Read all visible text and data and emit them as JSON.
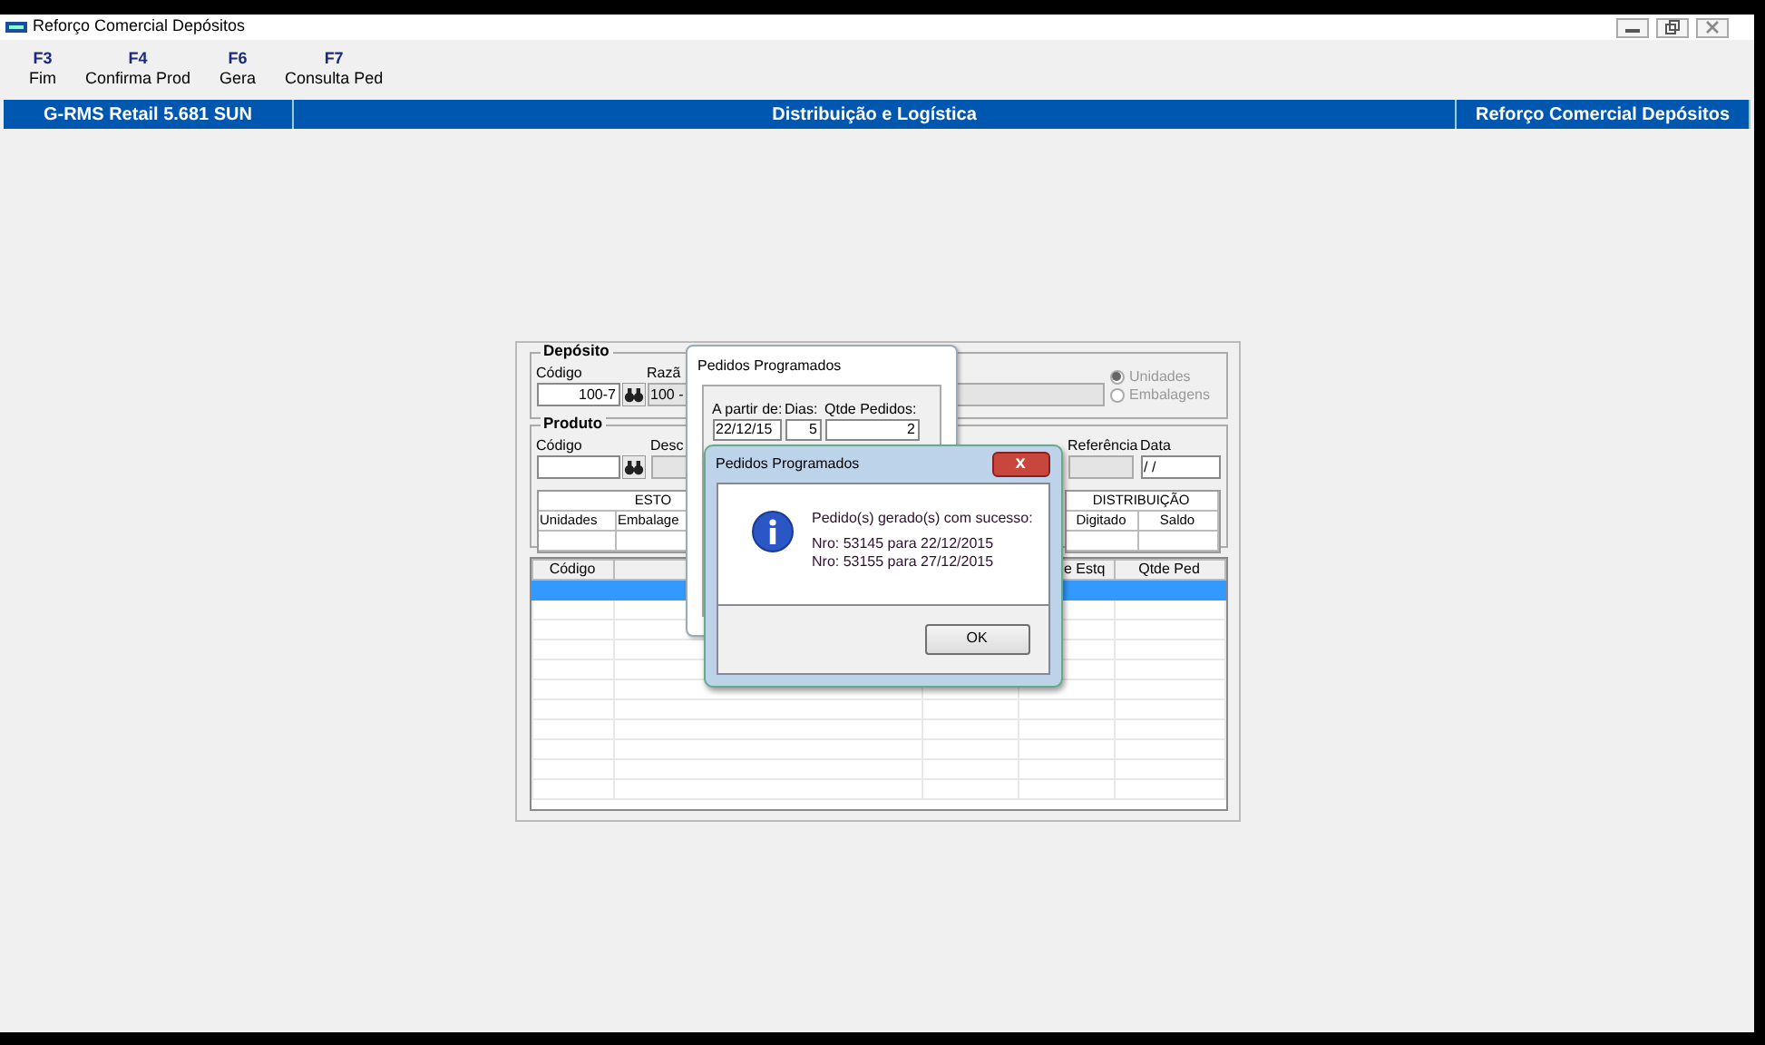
{
  "window": {
    "title": "Reforço Comercial Depósitos"
  },
  "function_keys": [
    {
      "key": "F3",
      "label": "Fim"
    },
    {
      "key": "F4",
      "label": "Confirma Prod"
    },
    {
      "key": "F6",
      "label": "Gera"
    },
    {
      "key": "F7",
      "label": "Consulta Ped"
    }
  ],
  "header_band": [
    "G-RMS Retail 5.681 SUN",
    "Distribuição e Logística",
    "Reforço Comercial Depósitos"
  ],
  "deposito": {
    "legend": "Depósito",
    "codigo_label": "Código",
    "codigo": "100-7",
    "razao_label": "Razã",
    "razao": "100 -"
  },
  "unit_options": {
    "disabled": true,
    "options": [
      {
        "label": "Unidades",
        "selected": true
      },
      {
        "label": "Embalagens",
        "selected": false
      }
    ]
  },
  "produto": {
    "legend": "Produto",
    "codigo_label": "Código",
    "descricao_label": "Desc",
    "referencia_label": "Referência",
    "data_label": "Data",
    "data": "/ /"
  },
  "estoque": {
    "title": "ESTO",
    "columns": [
      "Unidades",
      "Embalage"
    ]
  },
  "distribuicao": {
    "title": "DISTRIBUIÇÃO",
    "columns": [
      "Digitado",
      "Saldo"
    ]
  },
  "grid": {
    "columns": [
      "Código",
      "",
      "",
      "e Estq",
      "Qtde Ped"
    ],
    "rows": [
      {
        "selected": true
      },
      {
        "selected": false
      },
      {
        "selected": false
      },
      {
        "selected": false
      },
      {
        "selected": false
      },
      {
        "selected": false
      },
      {
        "selected": false
      },
      {
        "selected": false
      },
      {
        "selected": false
      },
      {
        "selected": false
      },
      {
        "selected": false
      }
    ]
  },
  "schedule_dialog": {
    "title": "Pedidos Programados",
    "fields": [
      {
        "label": "A partir de:",
        "value": "22/12/15"
      },
      {
        "label": "Dias:",
        "value": "5"
      },
      {
        "label": "Qtde Pedidos:",
        "value": "2"
      }
    ]
  },
  "message_dialog": {
    "title": "Pedidos Programados",
    "close": "x",
    "heading": "Pedido(s) gerado(s) com sucesso:",
    "lines": [
      "Nro: 53145 para 22/12/2015",
      "Nro: 53155 para 27/12/2015"
    ],
    "button": "OK"
  }
}
